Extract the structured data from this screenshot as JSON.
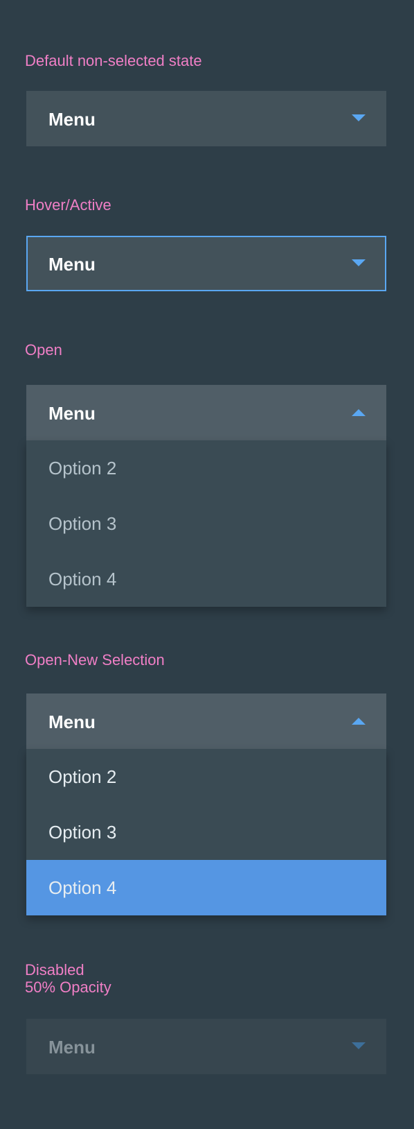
{
  "sections": {
    "default": {
      "label": "Default non-selected state",
      "menu_label": "Menu",
      "caret_icon": "caret-down-icon"
    },
    "hover": {
      "label": "Hover/Active",
      "menu_label": "Menu",
      "caret_icon": "caret-down-icon"
    },
    "open": {
      "label": "Open",
      "menu_label": "Menu",
      "caret_icon": "caret-up-icon",
      "options": [
        "Option 2",
        "Option 3",
        "Option 4"
      ]
    },
    "open_new": {
      "label": "Open-New Selection",
      "menu_label": "Menu",
      "caret_icon": "caret-up-icon",
      "options": [
        "Option 2",
        "Option 3",
        "Option 4"
      ],
      "selected_option": "Option 4"
    },
    "disabled": {
      "label_lines": [
        "Disabled",
        "50% Opacity"
      ],
      "menu_label": "Menu",
      "caret_icon": "caret-down-icon"
    }
  },
  "colors": {
    "background": "#2e3e48",
    "label_pink": "#f07fc6",
    "accent_blue": "#5aa7f2",
    "selected_blue": "#5596e3",
    "dropdown_default": "#43525a",
    "dropdown_open": "#505e67",
    "options_bg": "#3a4b54"
  }
}
